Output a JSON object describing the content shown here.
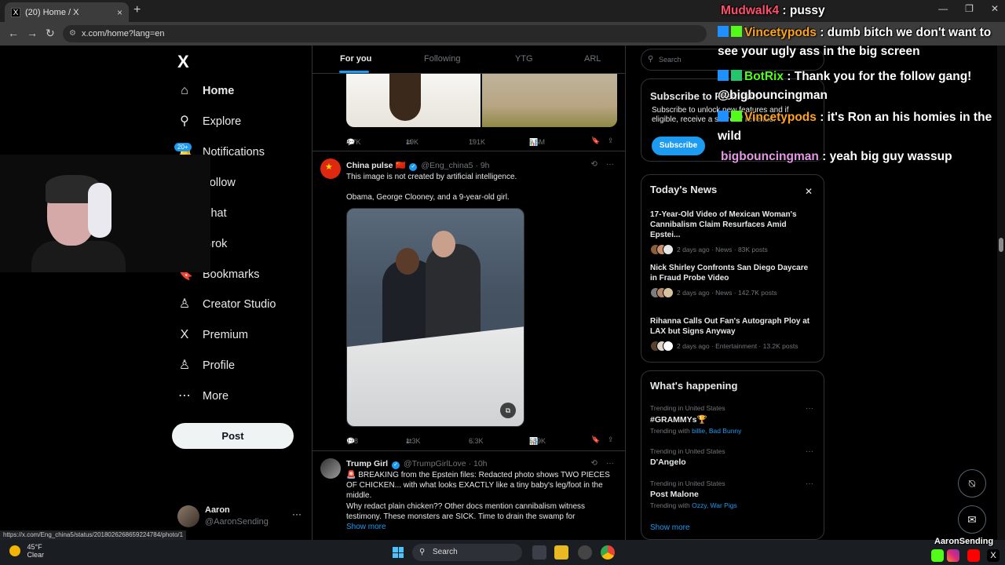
{
  "browser": {
    "tab_title": "(20) Home / X",
    "tab_close": "×",
    "new_tab": "+",
    "url": "x.com/home?lang=en",
    "controls": {
      "minimize": "—",
      "restore": "❐",
      "close": "✕"
    },
    "status_url": "https://x.com/Eng_china5/status/2018026268659224784/photo/1"
  },
  "sidebar": {
    "logo": "X",
    "notifications_badge": "20+",
    "items": [
      {
        "label": "Home",
        "icon": "home-icon",
        "glyph": "⌂"
      },
      {
        "label": "Explore",
        "icon": "search-icon",
        "glyph": "⚲"
      },
      {
        "label": "Notifications",
        "icon": "bell-icon",
        "glyph": "🔔"
      },
      {
        "label": "Follow",
        "icon": "follow-icon",
        "glyph": "👤"
      },
      {
        "label": "Chat",
        "icon": "chat-icon",
        "glyph": "✉"
      },
      {
        "label": "Grok",
        "icon": "grok-icon",
        "glyph": "◩"
      },
      {
        "label": "Bookmarks",
        "icon": "bookmark-icon",
        "glyph": "🔖"
      },
      {
        "label": "Creator Studio",
        "icon": "creator-studio-icon",
        "glyph": "♙"
      },
      {
        "label": "Premium",
        "icon": "x-premium-icon",
        "glyph": "X"
      },
      {
        "label": "Profile",
        "icon": "profile-icon",
        "glyph": "♙"
      },
      {
        "label": "More",
        "icon": "more-circle-icon",
        "glyph": "⋯"
      }
    ],
    "post_label": "Post",
    "account": {
      "name": "Aaron",
      "handle": "@AaronSending",
      "more": "···"
    }
  },
  "timeline": {
    "tabs": [
      "For you",
      "Following",
      "YTG",
      "ARL"
    ],
    "top_actions": {
      "replies": "4.7K",
      "reposts": "19K",
      "likes": "191K",
      "views": "9.6M"
    },
    "tweet1": {
      "name": "China pulse",
      "flag": "🇨🇳",
      "handle": "@Eng_china5",
      "time": "· 9h",
      "line1": "This image is not created by artificial intelligence.",
      "line2": "Obama, George Clooney, and a 9-year-old girl.",
      "actions": {
        "replies": "178",
        "reposts": "1.3K",
        "likes": "6.3K",
        "views": "659K"
      }
    },
    "tweet2": {
      "name": "Trump Girl",
      "handle": "@TrumpGirlLove",
      "time": "· 10h",
      "line1": "🚨 BREAKING from the Epstein files: Redacted photo shows TWO PIECES OF CHICKEN... with what looks EXACTLY like a tiny baby's leg/foot in the middle.",
      "line2": "Why redact plain chicken?? Other docs mention cannibalism witness testimony. These monsters are SICK. Time to drain the swamp for",
      "show_more": "Show more"
    },
    "icons": {
      "reply": "💬",
      "repost": "⇄",
      "like": "♡",
      "views": "📊",
      "bookmark": "🔖",
      "share": "⇪",
      "more": "···",
      "grok": "⟲"
    }
  },
  "right": {
    "search_placeholder": "Search",
    "subscribe": {
      "title": "Subscribe to Premium",
      "desc": "Subscribe to unlock new features and if eligible, receive a share of revenue.",
      "button": "Subscribe"
    },
    "news": {
      "title": "Today's News",
      "close": "✕",
      "items": [
        {
          "headline": "17-Year-Old Video of Mexican Woman's Cannibalism Claim Resurfaces Amid Epstei...",
          "meta": "2 days ago · News · 83K posts"
        },
        {
          "headline": "Nick Shirley Confronts San Diego Daycare in Fraud Probe Video",
          "meta": "2 days ago · News · 142.7K posts"
        },
        {
          "headline": "Rihanna Calls Out Fan's Autograph Ploy at LAX but Signs Anyway",
          "meta": "2 days ago · Entertainment · 13.2K posts"
        }
      ]
    },
    "happening": {
      "title": "What's happening",
      "trends": [
        {
          "context": "Trending in United States",
          "name": "#GRAMMYs🏆",
          "with_label": "Trending with",
          "with": "billie, Bad Bunny"
        },
        {
          "context": "Trending in United States",
          "name": "D'Angelo",
          "with_label": "",
          "with": ""
        },
        {
          "context": "Trending in United States",
          "name": "Post Malone",
          "with_label": "Trending with",
          "with": "Ozzy, War Pigs"
        }
      ],
      "more": "···",
      "show_more": "Show more"
    }
  },
  "chat": [
    {
      "user": "Mudwalk4",
      "color": "#ff4f6b",
      "text": ": pussy",
      "badges": []
    },
    {
      "user": "Vincetypods",
      "color": "#ffa31a",
      "text": ": dumb bitch we don't want to see your ugly ass in the big screen",
      "badges": [
        "#1e90ff",
        "#53fc18"
      ]
    },
    {
      "user": "BotRix",
      "color": "#53fc18",
      "text": ": Thank you for the follow gang! @bigbouncingman",
      "badges": [
        "#1e90ff",
        "#24c56b"
      ]
    },
    {
      "user": "Vincetypods",
      "color": "#ffa31a",
      "text": ": it's Ron an his homies in the wild",
      "badges": [
        "#1e90ff",
        "#53fc18"
      ]
    },
    {
      "user": "bigbouncingman",
      "color": "#e59ae5",
      "text": ": yeah big guy wassup",
      "badges": []
    }
  ],
  "fabs": {
    "grok": "⍉",
    "messages": "✉"
  },
  "taskbar": {
    "temp": "45°F",
    "condition": "Clear",
    "search": "Search",
    "brand": "AaronSending"
  }
}
